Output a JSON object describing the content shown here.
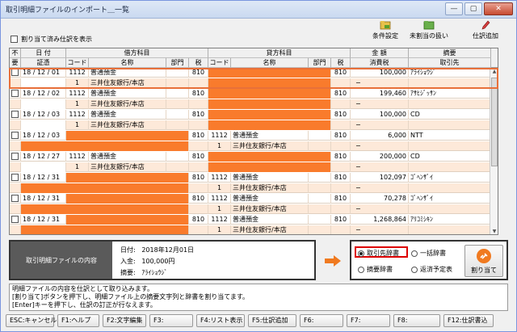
{
  "window": {
    "title": "取引明細ファイルのインポート＿一覧",
    "min": "—",
    "max": "▢",
    "close": "✕"
  },
  "filter": {
    "label": "割り当て済み仕訳を表示"
  },
  "toolbar": {
    "cond_label": "条件設定",
    "unassigned_label": "未割当の扱い",
    "add_label": "仕訳追加"
  },
  "grid": {
    "hdr_top": {
      "noreq": "不",
      "date": "日 付",
      "debit": "借方科目",
      "credit": "貸方科目",
      "amount": "金 額",
      "summary": "摘要"
    },
    "hdr_bot": {
      "noreq": "要",
      "voucher": "証憑",
      "dcode": "コード",
      "dname": "名称",
      "ddept": "部門",
      "dtax": "税",
      "ccode": "コード",
      "cname": "名称",
      "cdept": "部門",
      "ctax": "税",
      "tax": "消費税",
      "partner": "取引先"
    },
    "rows": [
      {
        "date": "18 / 12 / 01",
        "dcode": "1112",
        "dname": "普通預金",
        "dtax": "810",
        "corange": true,
        "ctax": "810",
        "amount": "100,000",
        "partner": "ｱﾗｲｼｮｳｼﾞ",
        "sub_dcode": "1",
        "sub_dname": "三井住友銀行/本店",
        "sub_tax": "−"
      },
      {
        "date": "18 / 12 / 02",
        "dcode": "1112",
        "dname": "普通預金",
        "dtax": "810",
        "corange": true,
        "ctax": "810",
        "amount": "199,460",
        "partner": "ｱｻﾋｼﾞｯｻﾝ",
        "sub_dcode": "1",
        "sub_dname": "三井住友銀行/本店",
        "sub_tax": "−"
      },
      {
        "date": "18 / 12 / 03",
        "dcode": "1112",
        "dname": "普通預金",
        "dtax": "810",
        "corange": true,
        "ctax": "810",
        "amount": "100,000",
        "partner": "CD",
        "sub_dcode": "1",
        "sub_dname": "三井住友銀行/本店",
        "sub_tax": "−"
      },
      {
        "date": "18 / 12 / 03",
        "dorange": true,
        "dtax": "810",
        "ccode": "1112",
        "cname": "普通預金",
        "ctax": "810",
        "amount": "6,000",
        "partner": "NTT",
        "sub_ccode": "1",
        "sub_cname": "三井住友銀行/本店",
        "sub_tax": "−"
      },
      {
        "date": "18 / 12 / 27",
        "dcode": "1112",
        "dname": "普通預金",
        "dtax": "810",
        "corange": true,
        "ctax": "810",
        "amount": "200,000",
        "partner": "CD",
        "sub_dcode": "1",
        "sub_dname": "三井住友銀行/本店",
        "sub_tax": "−"
      },
      {
        "date": "18 / 12 / 31",
        "dorange": true,
        "dtax": "810",
        "ccode": "1112",
        "cname": "普通預金",
        "ctax": "810",
        "amount": "102,097",
        "partner": "ｺﾞﾍﾝｻﾞｲ",
        "sub_ccode": "1",
        "sub_cname": "三井住友銀行/本店",
        "sub_tax": "−"
      },
      {
        "date": "18 / 12 / 31",
        "dorange": true,
        "dtax": "810",
        "ccode": "1112",
        "cname": "普通預金",
        "ctax": "810",
        "amount": "70,278",
        "partner": "ｺﾞﾍﾝｻﾞｲ",
        "sub_ccode": "1",
        "sub_cname": "三井住友銀行/本店",
        "sub_tax": "−"
      },
      {
        "date": "18 / 12 / 31",
        "dorange": true,
        "dtax": "810",
        "ccode": "1112",
        "cname": "普通預金",
        "ctax": "810",
        "amount": "1,268,864",
        "partner": "ｱﾘｺﾐｼｷﾝ",
        "sub_ccode": "1",
        "sub_cname": "三井住友銀行/本店",
        "sub_tax": "−"
      }
    ]
  },
  "info": {
    "section_label": "取引明細ファイルの内容",
    "date_key": "日付:",
    "date_val": "2018年12月01日",
    "amount_key": "入金:",
    "amount_val": "100,000円",
    "summary_key": "摘要:",
    "summary_val": "ｱﾗｲｼｮｳｼﾞ"
  },
  "options": {
    "partner_dict": "取引先辞書",
    "bulk_dict": "一括辞書",
    "summary_dict": "摘要辞書",
    "repay_schedule": "返済予定表",
    "assign_label": "割り当て"
  },
  "message": {
    "line1": "明細ファイルの内容を仕訳として取り込みます。",
    "line2": "[割り当て]ボタンを押下し、明細ファイル上の摘要文字列と辞書を割り当てます。",
    "line3": "[Enter]キーを押下し、仕訳の訂正が行なえます。"
  },
  "fkeys": [
    "ESC:キャンセル",
    "F1:ヘルプ",
    "F2:文字編集",
    "F3:",
    "F4:リスト表示",
    "F5:仕訳追加",
    "F6:",
    "F7:",
    "F8:",
    "F12:仕訳書込"
  ],
  "colors": {
    "orange": "#f97b2c",
    "peach": "#fde9d9",
    "highlight": "#dd0000"
  }
}
